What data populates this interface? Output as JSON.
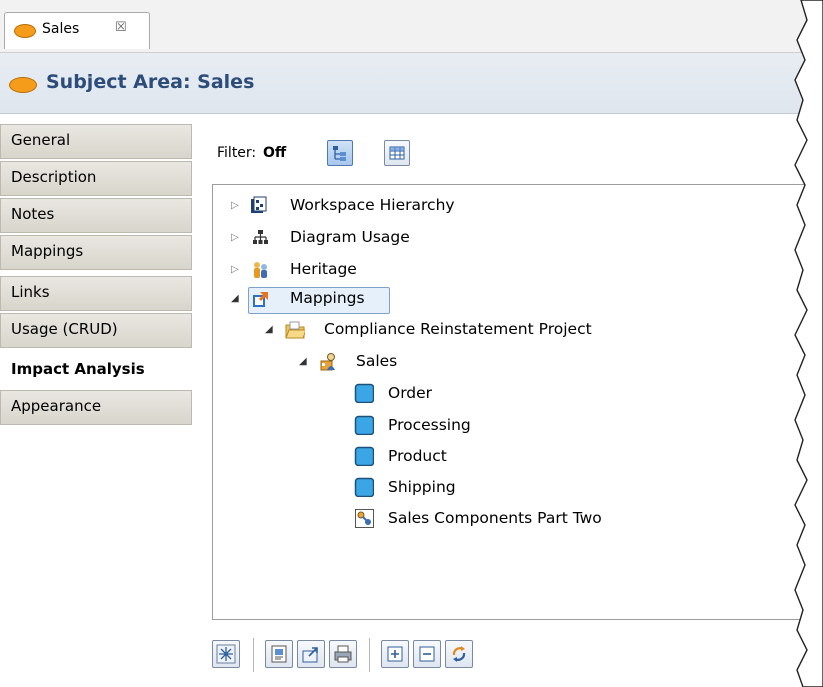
{
  "tab": {
    "label": "Sales",
    "close_glyph": "☒"
  },
  "header": {
    "title": "Subject Area: Sales"
  },
  "nav": {
    "items": [
      {
        "label": "General"
      },
      {
        "label": "Description"
      },
      {
        "label": "Notes"
      },
      {
        "label": "Mappings"
      },
      {
        "label": "Links"
      },
      {
        "label": "Usage (CRUD)"
      },
      {
        "label": "Impact Analysis",
        "active": true
      },
      {
        "label": "Appearance"
      }
    ]
  },
  "filter": {
    "label": "Filter:",
    "value": "Off"
  },
  "tree": {
    "workspace": "Workspace Hierarchy",
    "diagram": "Diagram Usage",
    "heritage": "Heritage",
    "mappings": "Mappings",
    "project": "Compliance Reinstatement Project",
    "sales": "Sales",
    "order": "Order",
    "processing": "Processing",
    "product": "Product",
    "shipping": "Shipping",
    "components": "Sales Components Part Two"
  },
  "colors": {
    "accent": "#2c4c79",
    "oval": "#f59d1b",
    "entity": "#3aa6e6"
  },
  "icons": [
    "tab-icon",
    "close-icon",
    "hierarchy-view-icon",
    "table-view-icon",
    "workspace-icon",
    "diagram-icon",
    "heritage-icon",
    "mappings-icon",
    "folder-icon",
    "model-icon",
    "entity-icon",
    "component-icon",
    "freeze-icon",
    "export-icon",
    "print-icon",
    "expand-all-icon",
    "collapse-all-icon",
    "refresh-icon"
  ]
}
